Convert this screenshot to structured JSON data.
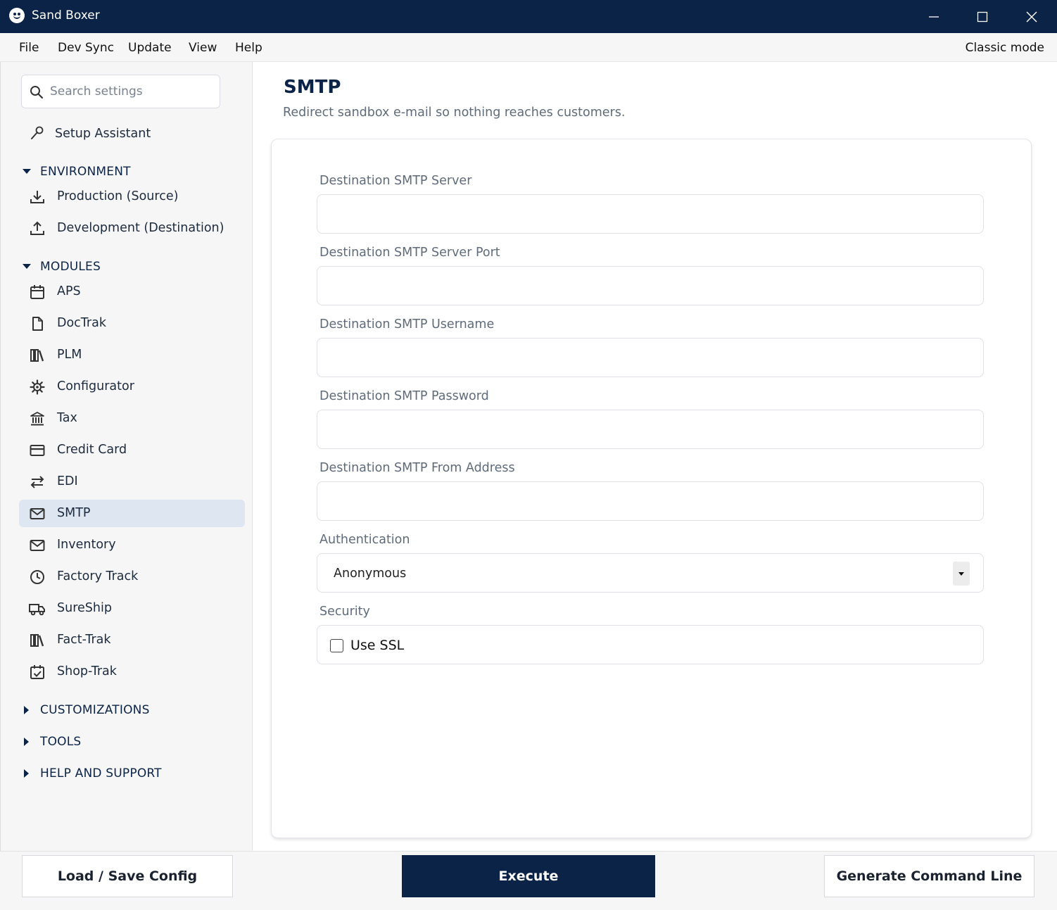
{
  "window": {
    "title": "Sand Boxer"
  },
  "menu": {
    "items": [
      "File",
      "Dev Sync",
      "Update",
      "View",
      "Help"
    ],
    "classic_mode": "Classic mode"
  },
  "sidebar": {
    "search": {
      "placeholder": "Search settings",
      "value": ""
    },
    "setup_assistant": "Setup Assistant",
    "sections": {
      "environment": "ENVIRONMENT",
      "modules": "MODULES",
      "customizations": "CUSTOMIZATIONS",
      "tools": "TOOLS",
      "help": "HELP AND SUPPORT"
    },
    "environment_items": [
      "Production (Source)",
      "Development (Destination)"
    ],
    "module_items": [
      "APS",
      "DocTrak",
      "PLM",
      "Configurator",
      "Tax",
      "Credit Card",
      "EDI",
      "SMTP",
      "Inventory",
      "Factory Track",
      "SureShip",
      "Fact-Trak",
      "Shop-Trak"
    ],
    "active_item": "SMTP"
  },
  "main": {
    "title": "SMTP",
    "subtitle": "Redirect sandbox e-mail so nothing reaches customers.",
    "fields": {
      "server": {
        "label": "Destination SMTP Server",
        "value": ""
      },
      "port": {
        "label": "Destination SMTP Server Port",
        "value": ""
      },
      "username": {
        "label": "Destination SMTP Username",
        "value": ""
      },
      "password": {
        "label": "Destination SMTP Password",
        "value": ""
      },
      "from": {
        "label": "Destination SMTP From Address",
        "value": ""
      }
    },
    "authentication": {
      "label": "Authentication",
      "value": "Anonymous"
    },
    "security": {
      "label": "Security",
      "checkbox_label": "Use SSL",
      "checked": false
    }
  },
  "footer": {
    "load_save": "Load / Save Config",
    "execute": "Execute",
    "generate": "Generate Command Line"
  },
  "colors": {
    "brand": "#0b2347",
    "active_bg": "#dde6f1"
  },
  "icons": {
    "setup_assistant": "wrench-icon",
    "production": "download-icon",
    "development": "upload-icon",
    "APS": "calendar-icon",
    "DocTrak": "document-icon",
    "PLM": "library-icon",
    "Configurator": "cog-icon",
    "Tax": "bank-icon",
    "Credit Card": "credit-card-icon",
    "EDI": "swap-icon",
    "SMTP": "mail-icon",
    "Inventory": "mail-icon",
    "Factory Track": "clock-icon",
    "SureShip": "truck-icon",
    "Fact-Trak": "library-icon",
    "Shop-Trak": "calendar-check-icon"
  }
}
